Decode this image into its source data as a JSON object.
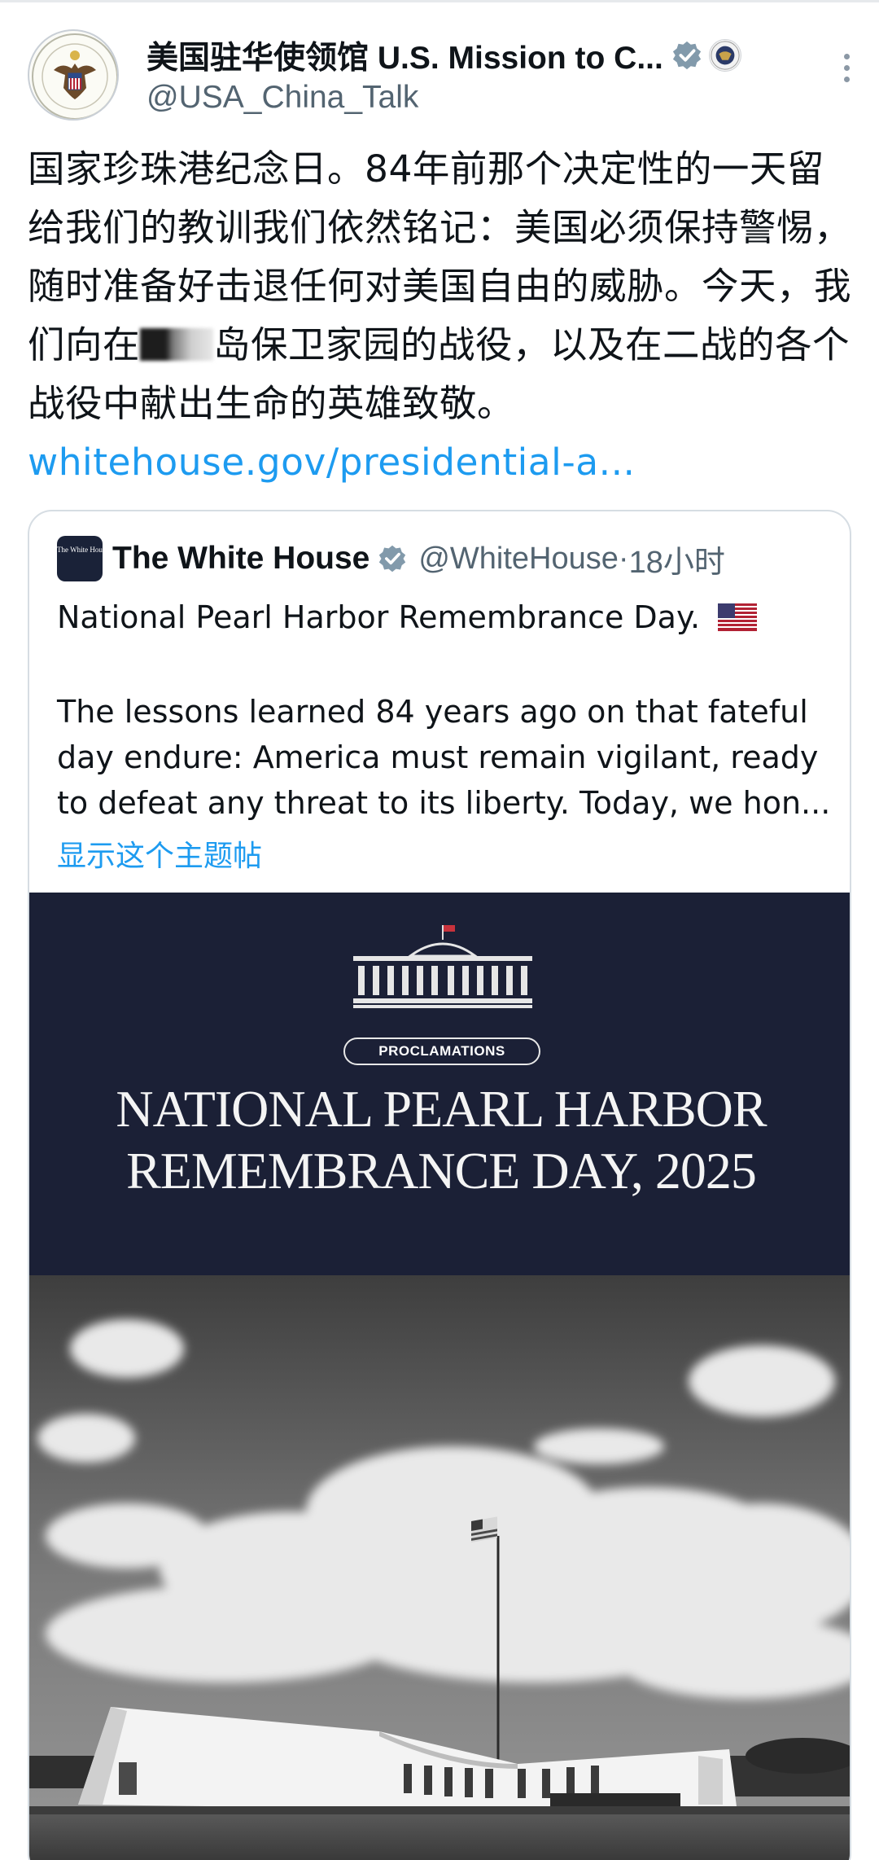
{
  "author": {
    "display_name": "美国驻华使领馆 U.S. Mission to C...",
    "handle": "@USA_China_Talk",
    "avatar_icon": "embassy-seal-icon",
    "badges": [
      "verified-badge-icon",
      "government-seal-icon"
    ]
  },
  "tweet": {
    "text_part1": "国家珍珠港纪念日。84年前那个决定性的一天留给我们的教训我们依然铭记：美国必须保持警惕，随时准备好击退任何对美国自由的威胁。今天，我们向在",
    "text_part2": "岛保卫家园的战役，以及在二战的各个战役中献出生命的英雄致敬。",
    "link": "whitehouse.gov/presidential-a..."
  },
  "quoted": {
    "logo_text": "The White House",
    "name": "The White House",
    "handle": "@WhiteHouse",
    "separator": " · ",
    "time": "18小时",
    "line1": "National Pearl Harbor Remembrance Day.",
    "body": "The lessons learned 84 years ago on that fateful day endure: America must remain vigilant, ready to defeat any threat to its liberty. Today, we hon...",
    "show_more": "显示这个主题帖"
  },
  "media": {
    "tag": "PROCLAMATIONS",
    "title_line1": "NATIONAL PEARL HARBOR",
    "title_line2": "REMEMBRANCE DAY, 2025"
  },
  "colors": {
    "link": "#1d9bf0",
    "secondary_text": "#536471",
    "banner_bg": "#1b2036",
    "border": "#d6dde3"
  }
}
